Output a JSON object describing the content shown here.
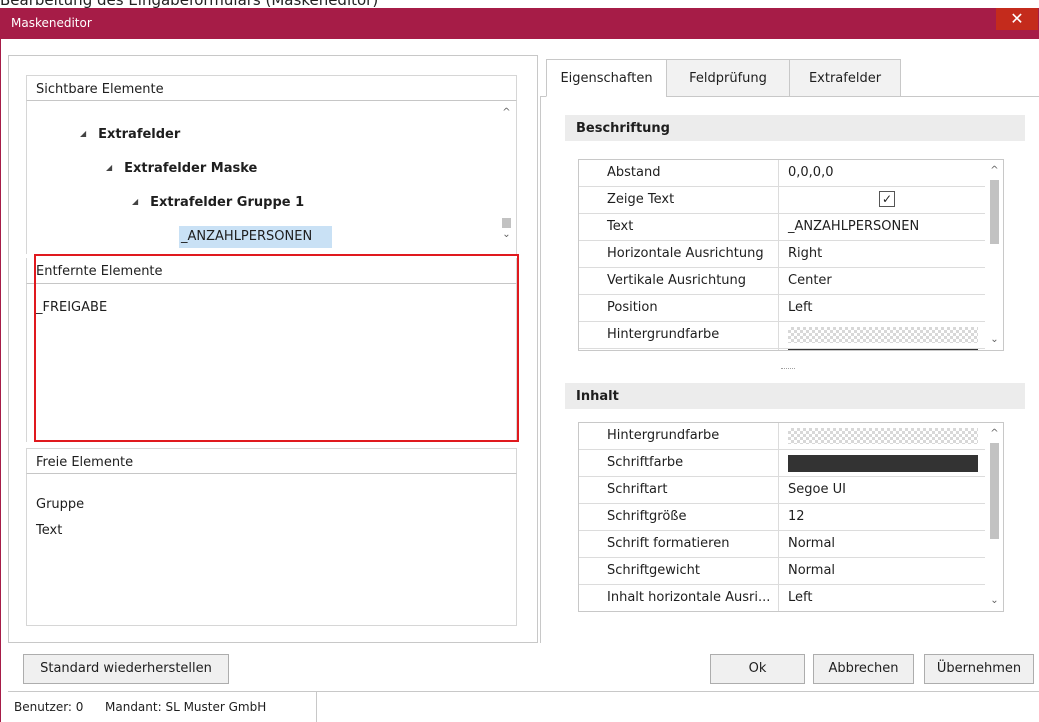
{
  "window": {
    "top_text": "Bearbeitung des Eingabeformulars (Maskeneditor)",
    "title": "Maskeneditor",
    "close_glyph": "✕",
    "title_color": "#a61c47"
  },
  "left": {
    "visible_section": {
      "label": "Sichtbare Elemente",
      "tree": [
        {
          "label": "Extrafelder",
          "expander": "◢"
        },
        {
          "label": "Extrafelder Maske",
          "expander": "◢"
        },
        {
          "label": "Extrafelder Gruppe 1",
          "expander": "◢"
        }
      ],
      "selected_item": "_ANZAHLPERSONEN"
    },
    "removed_section": {
      "label": "Entfernte Elemente",
      "items": [
        "_FREIGABE"
      ]
    },
    "free_section": {
      "label": "Freie Elemente",
      "items": [
        "Gruppe",
        "Text"
      ]
    }
  },
  "right": {
    "tabs": [
      {
        "label": "Eigenschaften",
        "active": true
      },
      {
        "label": "Feldprüfung",
        "active": false
      },
      {
        "label": "Extrafelder",
        "active": false
      }
    ],
    "beschriftung": {
      "header": "Beschriftung",
      "rows": [
        {
          "key": "Abstand",
          "value": "0,0,0,0"
        },
        {
          "key": "Zeige Text",
          "value": "✓",
          "type": "checkbox"
        },
        {
          "key": "Text",
          "value": "_ANZAHLPERSONEN"
        },
        {
          "key": "Horizontale Ausrichtung",
          "value": "Right"
        },
        {
          "key": "Vertikale Ausrichtung",
          "value": "Center"
        },
        {
          "key": "Position",
          "value": "Left"
        },
        {
          "key": "Hintergrundfarbe",
          "value": "",
          "type": "transparent"
        }
      ]
    },
    "inhalt": {
      "header": "Inhalt",
      "rows": [
        {
          "key": "Hintergrundfarbe",
          "value": "",
          "type": "transparent"
        },
        {
          "key": "Schriftfarbe",
          "value": "",
          "type": "color",
          "color": "#333333"
        },
        {
          "key": "Schriftart",
          "value": "Segoe UI"
        },
        {
          "key": "Schriftgröße",
          "value": "12"
        },
        {
          "key": "Schrift formatieren",
          "value": "Normal"
        },
        {
          "key": "Schriftgewicht",
          "value": "Normal"
        },
        {
          "key": "Inhalt horizontale Ausri...",
          "value": "Left"
        }
      ]
    }
  },
  "buttons": {
    "reset": "Standard wiederherstellen",
    "ok": "Ok",
    "cancel": "Abbrechen",
    "apply": "Übernehmen"
  },
  "status": {
    "user": "Benutzer:  0",
    "client": "Mandant: SL Muster GmbH"
  },
  "icons": {
    "scroll_up": "^",
    "scroll_down": "⌄"
  }
}
